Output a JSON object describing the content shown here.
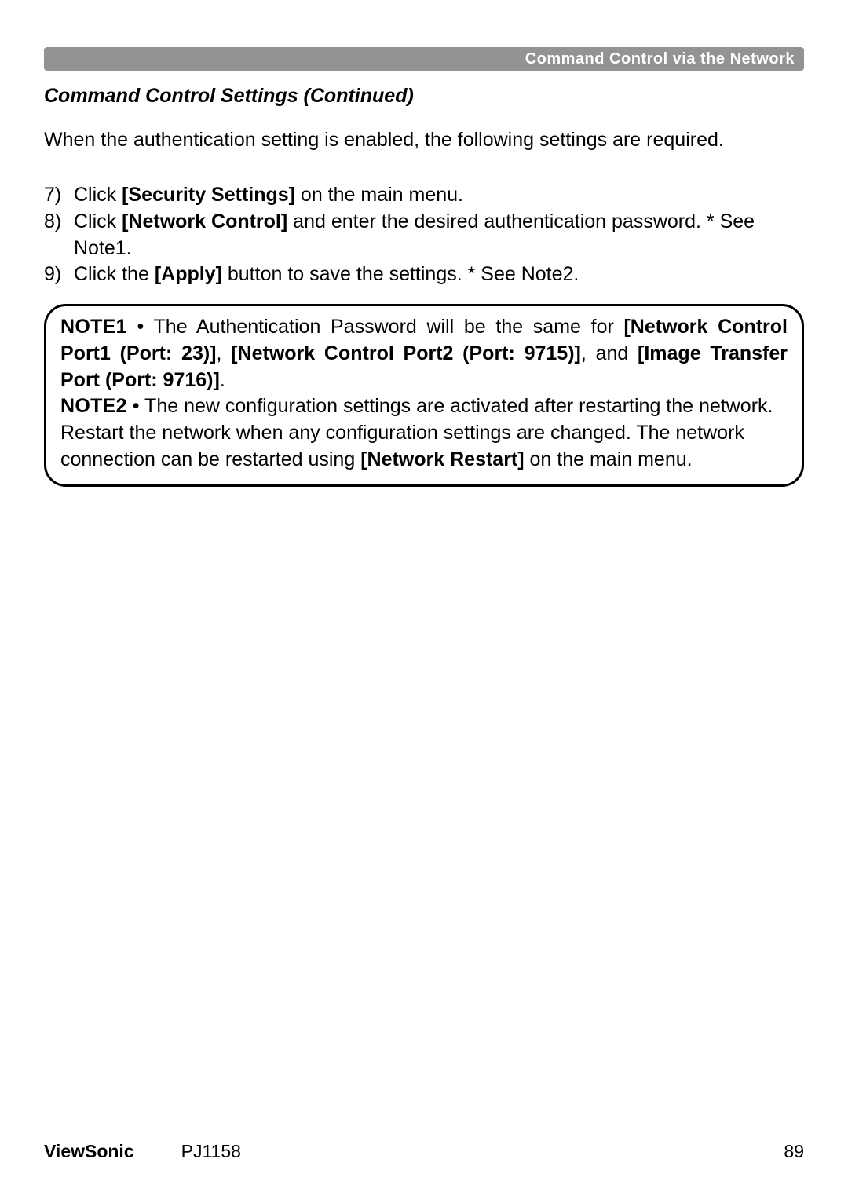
{
  "header": {
    "bar_text": "Command Control via the Network"
  },
  "section_title": "Command Control Settings (Continued)",
  "intro": "When the authentication setting is enabled, the following settings are required.",
  "steps": [
    {
      "num": "7)",
      "pre": "Click ",
      "bold": "[Security Settings]",
      "post": " on the main menu."
    },
    {
      "num": "8)",
      "pre": "Click ",
      "bold": "[Network Control]",
      "post": " and enter the desired authentication password. * See Note1."
    },
    {
      "num": "9)",
      "pre": "Click the ",
      "bold": "[Apply]",
      "post": " button to save the settings. * See Note2."
    }
  ],
  "notes": {
    "note1_label": "NOTE1",
    "note1_pre": "  • The Authentication Password will be the same for ",
    "note1_b1": "[Network Control Port1 (Port: 23)]",
    "note1_mid1": ", ",
    "note1_b2": "[Network Control Port2 (Port: 9715)]",
    "note1_mid2": ", and ",
    "note1_b3": "[Image Transfer Port (Port: 9716)]",
    "note1_end": ".",
    "note2_label": "NOTE2",
    "note2_pre": "  • The new configuration settings are activated after restarting the network. Restart the network when any configuration settings are changed. The network connection can be restarted using ",
    "note2_b1": "[Network Restart]",
    "note2_end": " on the main menu."
  },
  "footer": {
    "brand": "ViewSonic",
    "model": "PJ1158",
    "page": "89"
  }
}
